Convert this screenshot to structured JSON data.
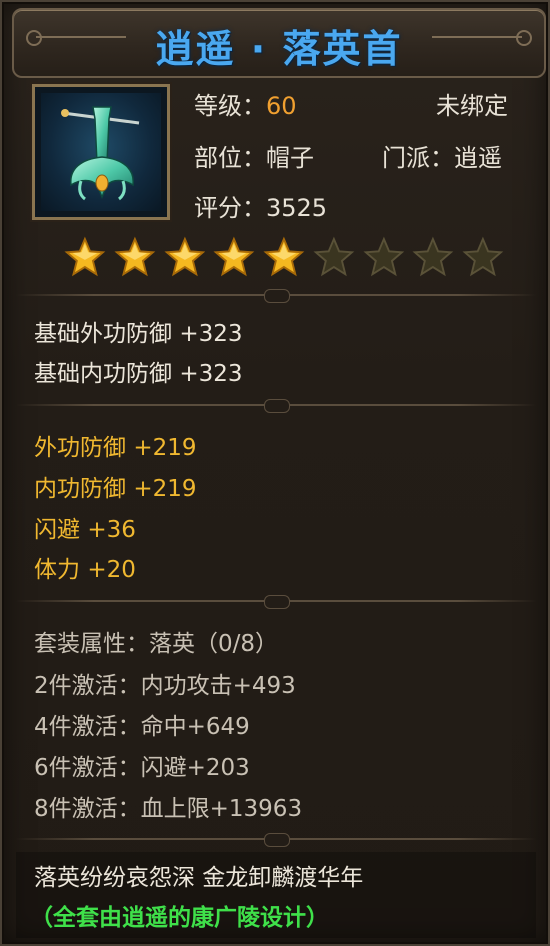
{
  "item": {
    "name": "逍遥 · 落英首",
    "level_label": "等级：",
    "level_value": "60",
    "bind_status": "未绑定",
    "slot_label": "部位：",
    "slot_value": "帽子",
    "sect_label": "门派：",
    "sect_value": "逍遥",
    "score_label": "评分：",
    "score_value": "3525",
    "icon": "jade-hairpin-icon"
  },
  "stars": {
    "filled": 5,
    "total": 9,
    "filled_color": "#f5b820",
    "empty_color": "#3a3520"
  },
  "base_stats": [
    {
      "name": "基础外功防御",
      "value": "+323"
    },
    {
      "name": "基础内功防御",
      "value": "+323"
    }
  ],
  "extra_stats": [
    {
      "name": "外功防御",
      "value": "+219"
    },
    {
      "name": "内功防御",
      "value": "+219"
    },
    {
      "name": "闪避",
      "value": "+36"
    },
    {
      "name": "体力",
      "value": "+20"
    }
  ],
  "set": {
    "header": "套装属性：落英（0/8）",
    "bonuses": [
      {
        "label": "2件激活：",
        "effect": "内功攻击+493"
      },
      {
        "label": "4件激活：",
        "effect": "命中+649"
      },
      {
        "label": "6件激活：",
        "effect": "闪避+203"
      },
      {
        "label": "8件激活：",
        "effect": "血上限+13963"
      }
    ]
  },
  "footer": {
    "poem": "落英纷纷哀怨深 金龙卸麟渡华年",
    "designer": "（全套由逍遥的康广陵设计）"
  },
  "colors": {
    "title": "#4aa8f0",
    "level_value": "#f0a030",
    "extra_stats": "#f0b830",
    "designer": "#3fe04a"
  }
}
